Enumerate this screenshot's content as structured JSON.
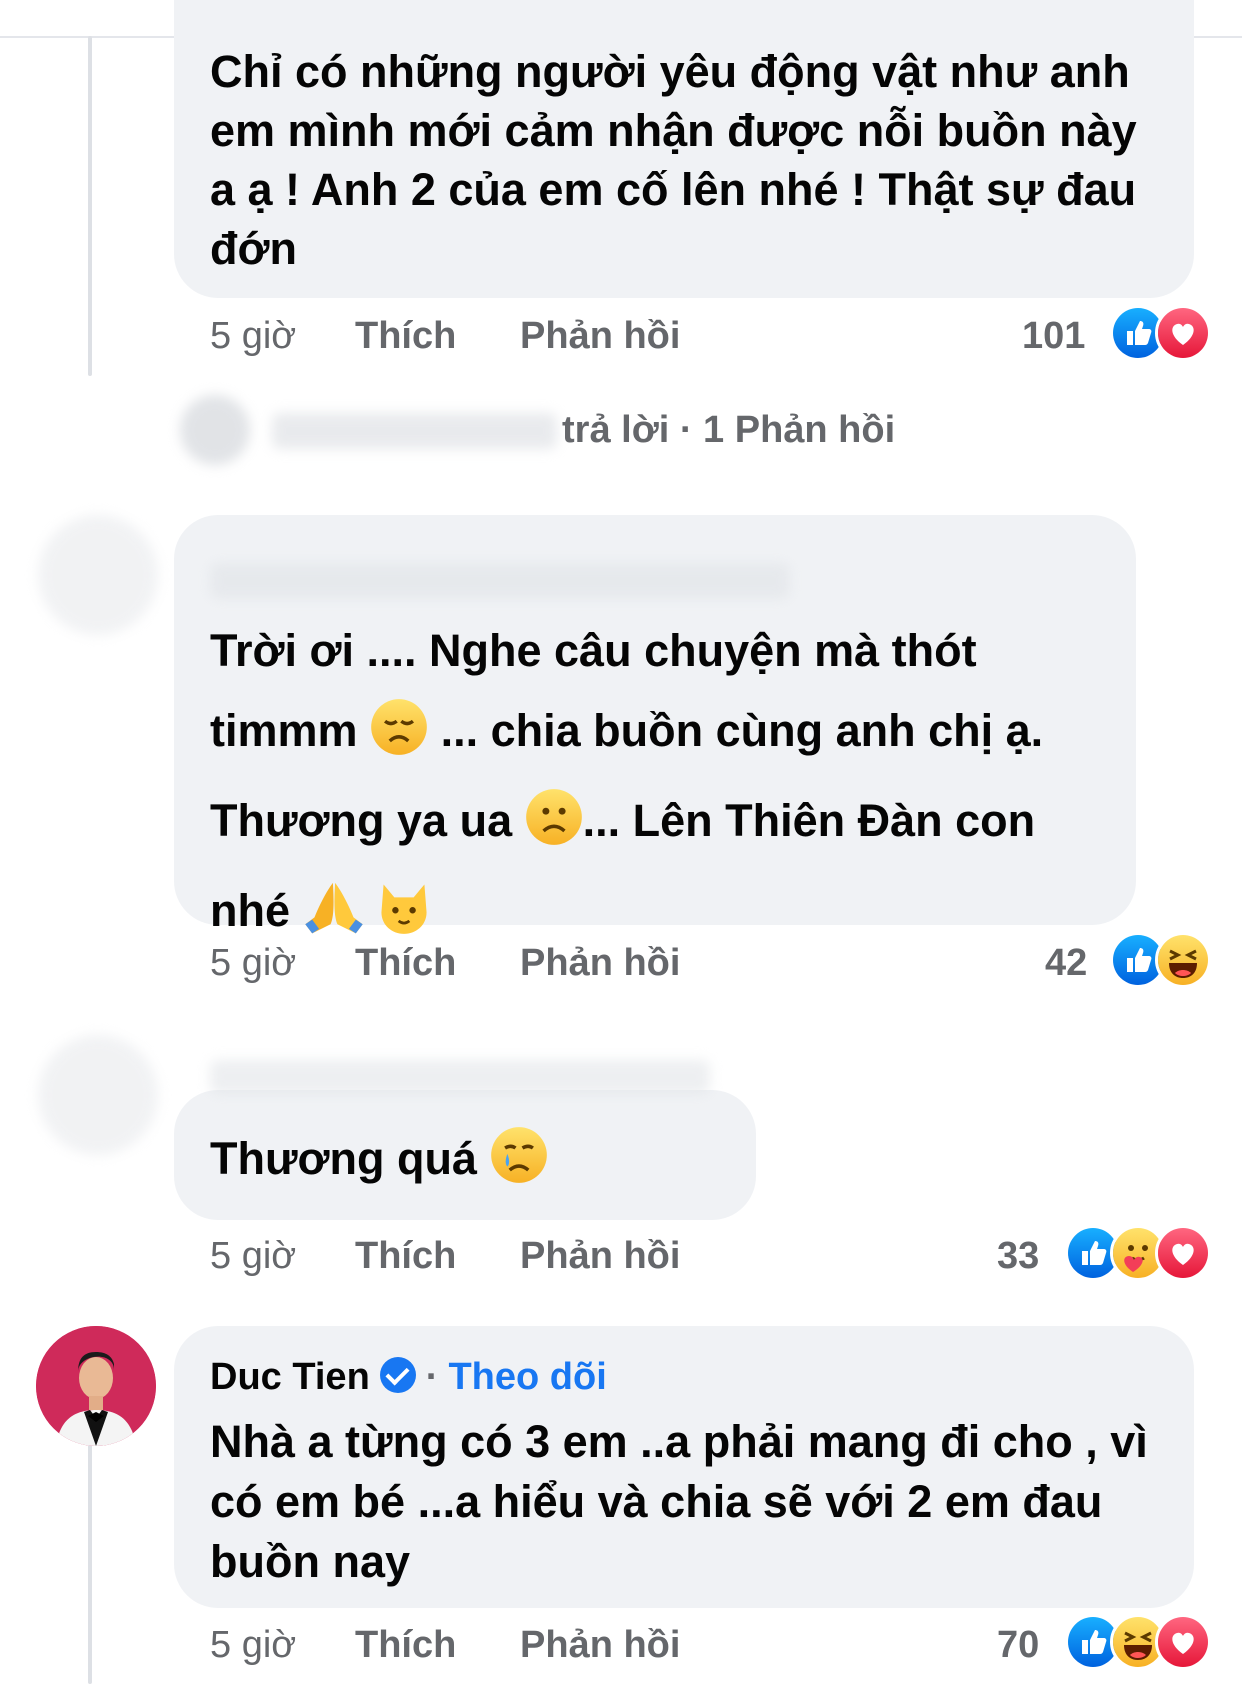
{
  "comments": [
    {
      "text": "Chỉ có những người yêu động vật như anh em mình mới cảm nhận được nỗi buồn này a ạ ! Anh 2 của em cố lên nhé ! Thật sự đau đớn",
      "time": "5 giờ",
      "like": "Thích",
      "reply": "Phản hồi",
      "count": "101",
      "reactions": [
        "like-icon",
        "love-icon"
      ]
    },
    {
      "line1": "Trời ơi .... Nghe câu chuyện mà thót",
      "line2a": "timmm",
      "line2b": "... chia buồn cùng anh chị ạ.",
      "line3a": "Thương ya ua",
      "line3b": "... Lên Thiên Đàn con",
      "line4": "nhé",
      "time": "5 giờ",
      "like": "Thích",
      "reply": "Phản hồi",
      "count": "42",
      "reactions": [
        "like-icon",
        "haha-icon"
      ]
    },
    {
      "text": "Thương quá",
      "time": "5 giờ",
      "like": "Thích",
      "reply": "Phản hồi",
      "count": "33",
      "reactions": [
        "like-icon",
        "care-icon",
        "love-icon"
      ]
    },
    {
      "author": "Duc Tien",
      "dot": "·",
      "follow": "Theo dõi",
      "text": "Nhà a từng có 3 em ..a phải mang đi cho , vì có em bé ...a hiểu và chia sẽ với 2 em đau buồn nay",
      "time": "5 giờ",
      "like": "Thích",
      "reply": "Phản hồi",
      "count": "70",
      "reactions": [
        "like-icon",
        "haha-icon",
        "love-icon"
      ]
    }
  ],
  "replies_summary": {
    "text": "trả lời · 1 Phản hồi"
  },
  "colors": {
    "like": "#1877f2",
    "love": "#f33e58",
    "bubble": "#f0f2f5",
    "meta": "#65676b"
  }
}
